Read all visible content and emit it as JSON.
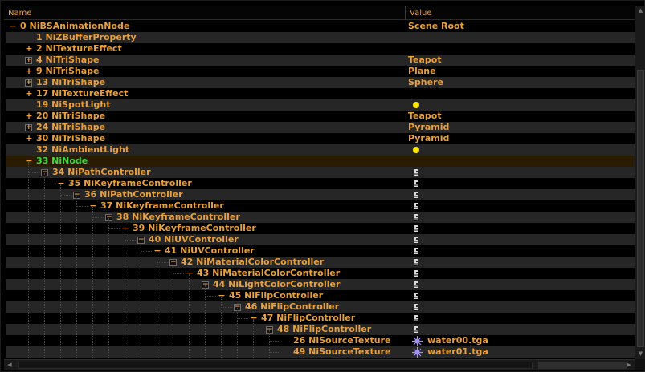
{
  "header": {
    "name_label": "Name",
    "value_label": "Value"
  },
  "rows": [
    {
      "id": "0",
      "label": "NiBSAnimationNode",
      "depth": 0,
      "expander": "minus",
      "value": "Scene Root",
      "icon": null
    },
    {
      "id": "1",
      "label": "NiZBufferProperty",
      "depth": 1,
      "expander": null,
      "value": "",
      "icon": null
    },
    {
      "id": "2",
      "label": "NiTextureEffect",
      "depth": 1,
      "expander": "plus",
      "value": "",
      "icon": null
    },
    {
      "id": "4",
      "label": "NiTriShape",
      "depth": 1,
      "expander": "boxplus",
      "value": "Teapot",
      "icon": null
    },
    {
      "id": "9",
      "label": "NiTriShape",
      "depth": 1,
      "expander": "plus",
      "value": "Plane",
      "icon": null
    },
    {
      "id": "13",
      "label": "NiTriShape",
      "depth": 1,
      "expander": "boxplus",
      "value": "Sphere",
      "icon": null
    },
    {
      "id": "17",
      "label": "NiTextureEffect",
      "depth": 1,
      "expander": "plus",
      "value": "",
      "icon": null
    },
    {
      "id": "19",
      "label": "NiSpotLight",
      "depth": 1,
      "expander": null,
      "value": "",
      "icon": "light-bulb-icon"
    },
    {
      "id": "20",
      "label": "NiTriShape",
      "depth": 1,
      "expander": "plus",
      "value": "Teapot",
      "icon": null
    },
    {
      "id": "24",
      "label": "NiTriShape",
      "depth": 1,
      "expander": "boxplus",
      "value": "Pyramid",
      "icon": null
    },
    {
      "id": "30",
      "label": "NiTriShape",
      "depth": 1,
      "expander": "plus",
      "value": "Pyramid",
      "icon": null
    },
    {
      "id": "32",
      "label": "NiAmbientLight",
      "depth": 1,
      "expander": null,
      "value": "",
      "icon": "light-bulb-icon"
    },
    {
      "id": "33",
      "label": "NiNode",
      "depth": 1,
      "expander": "minus",
      "value": "",
      "icon": null,
      "selected": true
    },
    {
      "id": "34",
      "label": "NiPathController",
      "depth": 2,
      "expander": "boxminus",
      "value": "",
      "icon": "controller-icon"
    },
    {
      "id": "35",
      "label": "NiKeyframeController",
      "depth": 3,
      "expander": "minus",
      "value": "",
      "icon": "controller-icon"
    },
    {
      "id": "36",
      "label": "NiPathController",
      "depth": 4,
      "expander": "boxminus",
      "value": "",
      "icon": "controller-icon"
    },
    {
      "id": "37",
      "label": "NiKeyframeController",
      "depth": 5,
      "expander": "minus",
      "value": "",
      "icon": "controller-icon"
    },
    {
      "id": "38",
      "label": "NiKeyframeController",
      "depth": 6,
      "expander": "boxminus",
      "value": "",
      "icon": "controller-icon"
    },
    {
      "id": "39",
      "label": "NiKeyframeController",
      "depth": 7,
      "expander": "minus",
      "value": "",
      "icon": "controller-icon"
    },
    {
      "id": "40",
      "label": "NiUVController",
      "depth": 8,
      "expander": "boxminus",
      "value": "",
      "icon": "controller-icon"
    },
    {
      "id": "41",
      "label": "NiUVController",
      "depth": 9,
      "expander": "minus",
      "value": "",
      "icon": "controller-icon"
    },
    {
      "id": "42",
      "label": "NiMaterialColorController",
      "depth": 10,
      "expander": "boxminus",
      "value": "",
      "icon": "controller-icon"
    },
    {
      "id": "43",
      "label": "NiMaterialColorController",
      "depth": 11,
      "expander": "minus",
      "value": "",
      "icon": "controller-icon"
    },
    {
      "id": "44",
      "label": "NiLightColorController",
      "depth": 12,
      "expander": "boxminus",
      "value": "",
      "icon": "controller-icon"
    },
    {
      "id": "45",
      "label": "NiFlipController",
      "depth": 13,
      "expander": "minus",
      "value": "",
      "icon": "controller-icon"
    },
    {
      "id": "46",
      "label": "NiFlipController",
      "depth": 14,
      "expander": "boxminus",
      "value": "",
      "icon": "controller-icon"
    },
    {
      "id": "47",
      "label": "NiFlipController",
      "depth": 15,
      "expander": "minus",
      "value": "",
      "icon": "controller-icon"
    },
    {
      "id": "48",
      "label": "NiFlipController",
      "depth": 16,
      "expander": "boxminus",
      "value": "",
      "icon": "controller-icon"
    },
    {
      "id": "26",
      "label": "NiSourceTexture",
      "depth": 17,
      "expander": null,
      "value": "water00.tga",
      "icon": "texture-icon"
    },
    {
      "id": "49",
      "label": "NiSourceTexture",
      "depth": 17,
      "expander": null,
      "value": "water01.tga",
      "icon": "texture-icon"
    }
  ],
  "colors": {
    "text": "#e8a03c",
    "selected_text": "#3dd93d",
    "background": "#000000",
    "alt_row": "#262626",
    "light": "#ffe800"
  }
}
